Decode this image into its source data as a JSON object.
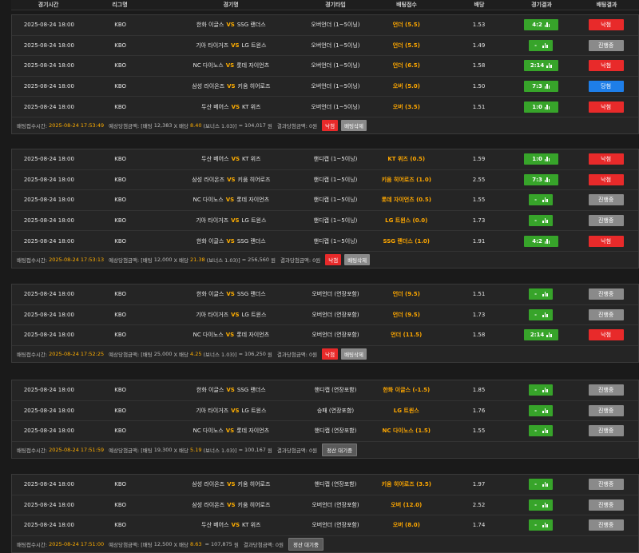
{
  "colors": {
    "lose": "#e82a2a",
    "pending": "#8a8a8a",
    "win": "#1e7ee8",
    "score": "#37a42a",
    "accent": "#ffae00"
  },
  "header": [
    "경기시간",
    "리그명",
    "경기명",
    "경기타입",
    "배팅접수",
    "배당",
    "경기결과",
    "배팅결과"
  ],
  "slips": [
    {
      "rows": [
        {
          "time": "2025-08-24 18:00",
          "league": "KBO",
          "home": "한화 이글스",
          "vs": "VS",
          "away": "SSG 랜더스",
          "type": "오버언더 (1~5이닝)",
          "pick": "언더 (5.5)",
          "odds": "1.53",
          "score": "4:2",
          "status": "낙첨",
          "status_color": "#e82a2a"
        },
        {
          "time": "2025-08-24 18:00",
          "league": "KBO",
          "home": "기아 타이거즈",
          "vs": "VS",
          "away": "LG 트윈스",
          "type": "오버언더 (1~5이닝)",
          "pick": "언더 (5.5)",
          "odds": "1.49",
          "score": "-",
          "status": "진행중",
          "status_color": "#8a8a8a"
        },
        {
          "time": "2025-08-24 18:00",
          "league": "KBO",
          "home": "NC 다이노스",
          "vs": "VS",
          "away": "롯데 자이언츠",
          "type": "오버언더 (1~5이닝)",
          "pick": "언더 (6.5)",
          "odds": "1.58",
          "score": "2:14",
          "status": "낙첨",
          "status_color": "#e82a2a"
        },
        {
          "time": "2025-08-24 18:00",
          "league": "KBO",
          "home": "삼성 라이온즈",
          "vs": "VS",
          "away": "키움 히어로즈",
          "type": "오버언더 (1~5이닝)",
          "pick": "오버 (5.0)",
          "odds": "1.50",
          "score": "7:3",
          "status": "당첨",
          "status_color": "#1e7ee8"
        },
        {
          "time": "2025-08-24 18:00",
          "league": "KBO",
          "home": "두산 베어스",
          "vs": "VS",
          "away": "KT 위즈",
          "type": "오버언더 (1~5이닝)",
          "pick": "오버 (3.5)",
          "odds": "1.51",
          "score": "1:0",
          "status": "낙첨",
          "status_color": "#e82a2a"
        }
      ],
      "summary": {
        "label": "배팅접수시간:",
        "datetime": "2025-08-24 17:53:49",
        "exp_label": "예상당첨금액: [배팅",
        "stake": "12,383",
        "x_label": "X 배당",
        "odds": "8.40",
        "bonus": "(보너스 1.03)]",
        "eq": "=",
        "amount": "104,017",
        "unit": "원",
        "result_label": "결과당첨금액:",
        "result": "0원",
        "state": "낙첨",
        "del": "배팅삭제"
      }
    },
    {
      "rows": [
        {
          "time": "2025-08-24 18:00",
          "league": "KBO",
          "home": "두산 베어스",
          "vs": "VS",
          "away": "KT 위즈",
          "type": "핸디캡 (1~5이닝)",
          "pick": "KT 위즈 (0.5)",
          "odds": "1.59",
          "score": "1:0",
          "status": "낙첨",
          "status_color": "#e82a2a"
        },
        {
          "time": "2025-08-24 18:00",
          "league": "KBO",
          "home": "삼성 라이온즈",
          "vs": "VS",
          "away": "키움 히어로즈",
          "type": "핸디캡 (1~5이닝)",
          "pick": "키움 히어로즈 (1.0)",
          "odds": "2.55",
          "score": "7:3",
          "status": "낙첨",
          "status_color": "#e82a2a"
        },
        {
          "time": "2025-08-24 18:00",
          "league": "KBO",
          "home": "NC 다이노스",
          "vs": "VS",
          "away": "롯데 자이언츠",
          "type": "핸디캡 (1~5이닝)",
          "pick": "롯데 자이언츠 (0.5)",
          "odds": "1.55",
          "score": "-",
          "status": "진행중",
          "status_color": "#8a8a8a"
        },
        {
          "time": "2025-08-24 18:00",
          "league": "KBO",
          "home": "기아 타이거즈",
          "vs": "VS",
          "away": "LG 트윈스",
          "type": "핸디캡 (1~5이닝)",
          "pick": "LG 트윈스 (0.0)",
          "odds": "1.73",
          "score": "-",
          "status": "진행중",
          "status_color": "#8a8a8a"
        },
        {
          "time": "2025-08-24 18:00",
          "league": "KBO",
          "home": "한화 이글스",
          "vs": "VS",
          "away": "SSG 랜더스",
          "type": "핸디캡 (1~5이닝)",
          "pick": "SSG 랜더스 (1.0)",
          "odds": "1.91",
          "score": "4:2",
          "status": "낙첨",
          "status_color": "#e82a2a"
        }
      ],
      "summary": {
        "label": "배팅접수시간:",
        "datetime": "2025-08-24 17:53:13",
        "exp_label": "예상당첨금액: [배팅",
        "stake": "12,000",
        "x_label": "X 배당",
        "odds": "21.38",
        "bonus": "(보너스 1.03)]",
        "eq": "=",
        "amount": "256,560",
        "unit": "원",
        "result_label": "결과당첨금액:",
        "result": "0원",
        "state": "낙첨",
        "del": "배팅삭제"
      }
    },
    {
      "rows": [
        {
          "time": "2025-08-24 18:00",
          "league": "KBO",
          "home": "한화 이글스",
          "vs": "VS",
          "away": "SSG 랜더스",
          "type": "오버언더 (연장포함)",
          "pick": "언더 (9.5)",
          "odds": "1.51",
          "score": "-",
          "status": "진행중",
          "status_color": "#8a8a8a"
        },
        {
          "time": "2025-08-24 18:00",
          "league": "KBO",
          "home": "기아 타이거즈",
          "vs": "VS",
          "away": "LG 트윈스",
          "type": "오버언더 (연장포함)",
          "pick": "언더 (9.5)",
          "odds": "1.73",
          "score": "-",
          "status": "진행중",
          "status_color": "#8a8a8a"
        },
        {
          "time": "2025-08-24 18:00",
          "league": "KBO",
          "home": "NC 다이노스",
          "vs": "VS",
          "away": "롯데 자이언츠",
          "type": "오버언더 (연장포함)",
          "pick": "언더 (11.5)",
          "odds": "1.58",
          "score": "2:14",
          "status": "낙첨",
          "status_color": "#e82a2a"
        }
      ],
      "summary": {
        "label": "배팅접수시간:",
        "datetime": "2025-08-24 17:52:25",
        "exp_label": "예상당첨금액: [배팅",
        "stake": "25,000",
        "x_label": "X 배당",
        "odds": "4.25",
        "bonus": "(보너스 1.03)]",
        "eq": "=",
        "amount": "106,250",
        "unit": "원",
        "result_label": "결과당첨금액:",
        "result": "0원",
        "state": "낙첨",
        "del": "배팅삭제"
      }
    },
    {
      "rows": [
        {
          "time": "2025-08-24 18:00",
          "league": "KBO",
          "home": "한화 이글스",
          "vs": "VS",
          "away": "SSG 랜더스",
          "type": "핸디캡 (연장포함)",
          "pick": "한화 이글스 (-1.5)",
          "odds": "1.85",
          "score": "-",
          "status": "진행중",
          "status_color": "#8a8a8a"
        },
        {
          "time": "2025-08-24 18:00",
          "league": "KBO",
          "home": "기아 타이거즈",
          "vs": "VS",
          "away": "LG 트윈스",
          "type": "승패 (연장포함)",
          "pick": "LG 트윈스",
          "odds": "1.76",
          "score": "-",
          "status": "진행중",
          "status_color": "#8a8a8a"
        },
        {
          "time": "2025-08-24 18:00",
          "league": "KBO",
          "home": "NC 다이노스",
          "vs": "VS",
          "away": "롯데 자이언츠",
          "type": "핸디캡 (연장포함)",
          "pick": "NC 다이노스 (1.5)",
          "odds": "1.55",
          "score": "-",
          "status": "진행중",
          "status_color": "#8a8a8a"
        }
      ],
      "summary": {
        "label": "배팅접수시간:",
        "datetime": "2025-08-24 17:51:59",
        "exp_label": "예상당첨금액: [배팅",
        "stake": "19,300",
        "x_label": "X 배당",
        "odds": "5.19",
        "bonus": "(보너스 1.03)]",
        "eq": "=",
        "amount": "100,167",
        "unit": "원",
        "result_label": "결과당첨금액:",
        "result": "0원",
        "state": "정산 대기중",
        "del": ""
      }
    },
    {
      "rows": [
        {
          "time": "2025-08-24 18:00",
          "league": "KBO",
          "home": "삼성 라이온즈",
          "vs": "VS",
          "away": "키움 히어로즈",
          "type": "핸디캡 (연장포함)",
          "pick": "키움 히어로즈 (3.5)",
          "odds": "1.97",
          "score": "-",
          "status": "진행중",
          "status_color": "#8a8a8a"
        },
        {
          "time": "2025-08-24 18:00",
          "league": "KBO",
          "home": "삼성 라이온즈",
          "vs": "VS",
          "away": "키움 히어로즈",
          "type": "오버언더 (연장포함)",
          "pick": "오버 (12.0)",
          "odds": "2.52",
          "score": "-",
          "status": "진행중",
          "status_color": "#8a8a8a"
        },
        {
          "time": "2025-08-24 18:00",
          "league": "KBO",
          "home": "두산 베어스",
          "vs": "VS",
          "away": "KT 위즈",
          "type": "오버언더 (연장포함)",
          "pick": "오버 (8.0)",
          "odds": "1.74",
          "score": "-",
          "status": "진행중",
          "status_color": "#8a8a8a"
        }
      ],
      "summary": {
        "label": "배팅접수시간:",
        "datetime": "2025-08-24 17:51:00",
        "exp_label": "예상당첨금액: [배팅",
        "stake": "12,500",
        "x_label": "X 배당",
        "odds": "8.63",
        "bonus": "",
        "eq": "=",
        "amount": "107,875",
        "unit": "원",
        "result_label": "결과당첨금액:",
        "result": "0원",
        "state": "정산 대기중",
        "del": ""
      }
    }
  ]
}
